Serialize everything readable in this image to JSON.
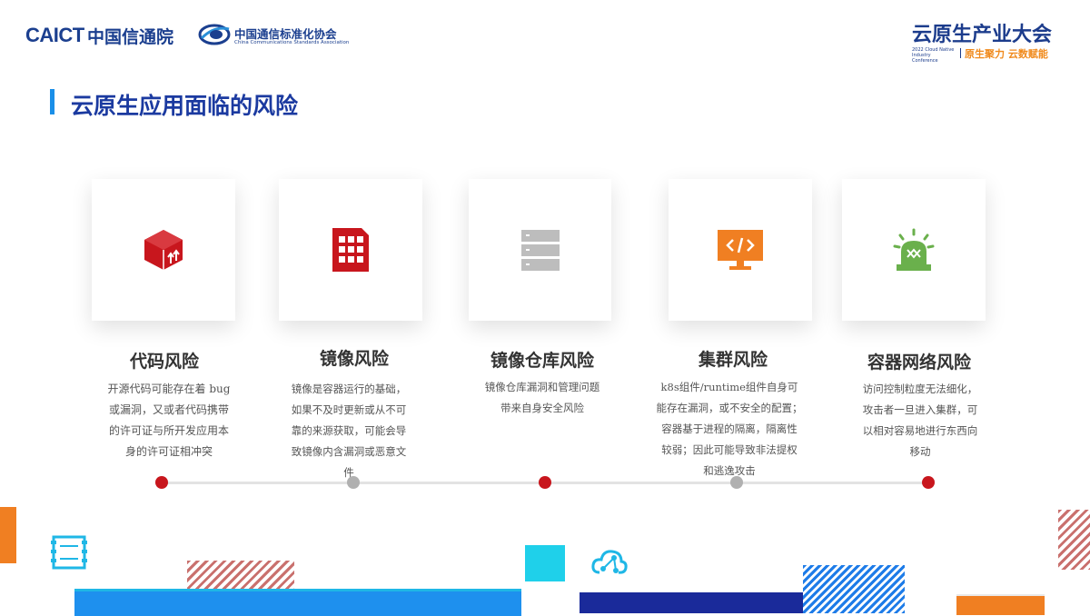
{
  "header": {
    "caict_logo": "CAICT",
    "caict_name": "中国信通院",
    "ccsa_name": "中国通信标准化协会",
    "ccsa_en": "China Communications Standards Association",
    "conference_title": "云原生产业大会",
    "conference_en": "2022 Cloud Native Industry Conference",
    "conference_slogan": "原生聚力 云数赋能"
  },
  "page_title": "云原生应用面临的风险",
  "risks": [
    {
      "title": "代码风险",
      "icon": "box-upload-icon",
      "color": "#c8161d",
      "desc": [
        "开源代码可能存在着 bug",
        "或漏洞，又或者代码携带",
        "的许可证与所开发应用本",
        "身的许可证相冲突"
      ]
    },
    {
      "title": "镜像风险",
      "icon": "building-icon",
      "color": "#c8161d",
      "desc": [
        "镜像是容器运行的基础，",
        "如果不及时更新或从不可",
        "靠的来源获取，可能会导",
        "致镜像内含漏洞或恶意文",
        "件"
      ]
    },
    {
      "title": "镜像仓库风险",
      "icon": "server-stack-icon",
      "color": "#bdbdbd",
      "desc": [
        "镜像仓库漏洞和管理问题",
        "带来自身安全风险"
      ]
    },
    {
      "title": "集群风险",
      "icon": "monitor-code-icon",
      "color": "#f07f22",
      "desc": [
        "k8s组件/runtime组件自身可",
        "能存在漏洞，或不安全的配置；",
        "容器基于进程的隔离，隔离性",
        "较弱；因此可能导致非法提权",
        "和逃逸攻击"
      ]
    },
    {
      "title": "容器网络风险",
      "icon": "alarm-light-icon",
      "color": "#6ab04c",
      "desc": [
        "访问控制粒度无法细化，",
        "攻击者一旦进入集群，可",
        "以相对容易地进行东西向",
        "移动"
      ]
    }
  ],
  "timeline_dot_colors": [
    "#c8161d",
    "#b0b0b0",
    "#c8161d",
    "#b0b0b0",
    "#c8161d"
  ]
}
